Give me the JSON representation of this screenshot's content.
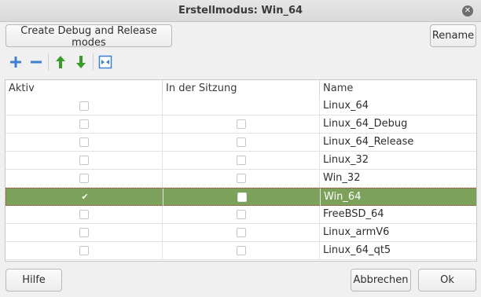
{
  "window": {
    "title": "Erstellmodus: Win_64"
  },
  "top_buttons": {
    "create_label": "Create Debug and Release modes",
    "rename_label": "Rename"
  },
  "toolbar": {
    "add_icon": "plus-icon",
    "remove_icon": "minus-icon",
    "up_icon": "arrow-up-icon",
    "down_icon": "arrow-down-icon",
    "diff_icon": "compare-icon"
  },
  "table": {
    "columns": [
      "Aktiv",
      "In der Sitzung",
      "Name"
    ],
    "rows": [
      {
        "name": "Linux_64",
        "active": false,
        "in_session": null,
        "selected": false
      },
      {
        "name": "Linux_64_Debug",
        "active": false,
        "in_session": false,
        "selected": false
      },
      {
        "name": "Linux_64_Release",
        "active": false,
        "in_session": false,
        "selected": false
      },
      {
        "name": "Linux_32",
        "active": false,
        "in_session": false,
        "selected": false
      },
      {
        "name": "Win_32",
        "active": false,
        "in_session": false,
        "selected": false
      },
      {
        "name": "Win_64",
        "active": true,
        "in_session": false,
        "selected": true
      },
      {
        "name": "FreeBSD_64",
        "active": false,
        "in_session": false,
        "selected": false
      },
      {
        "name": "Linux_armV6",
        "active": false,
        "in_session": false,
        "selected": false
      },
      {
        "name": "Linux_64_qt5",
        "active": false,
        "in_session": false,
        "selected": false
      }
    ]
  },
  "bottom_buttons": {
    "help_label": "Hilfe",
    "cancel_label": "Abbrechen",
    "ok_label": "Ok"
  },
  "colors": {
    "selection": "#7ba15b",
    "arrow_green": "#3a9a2a",
    "icon_blue": "#3f7fcf"
  }
}
